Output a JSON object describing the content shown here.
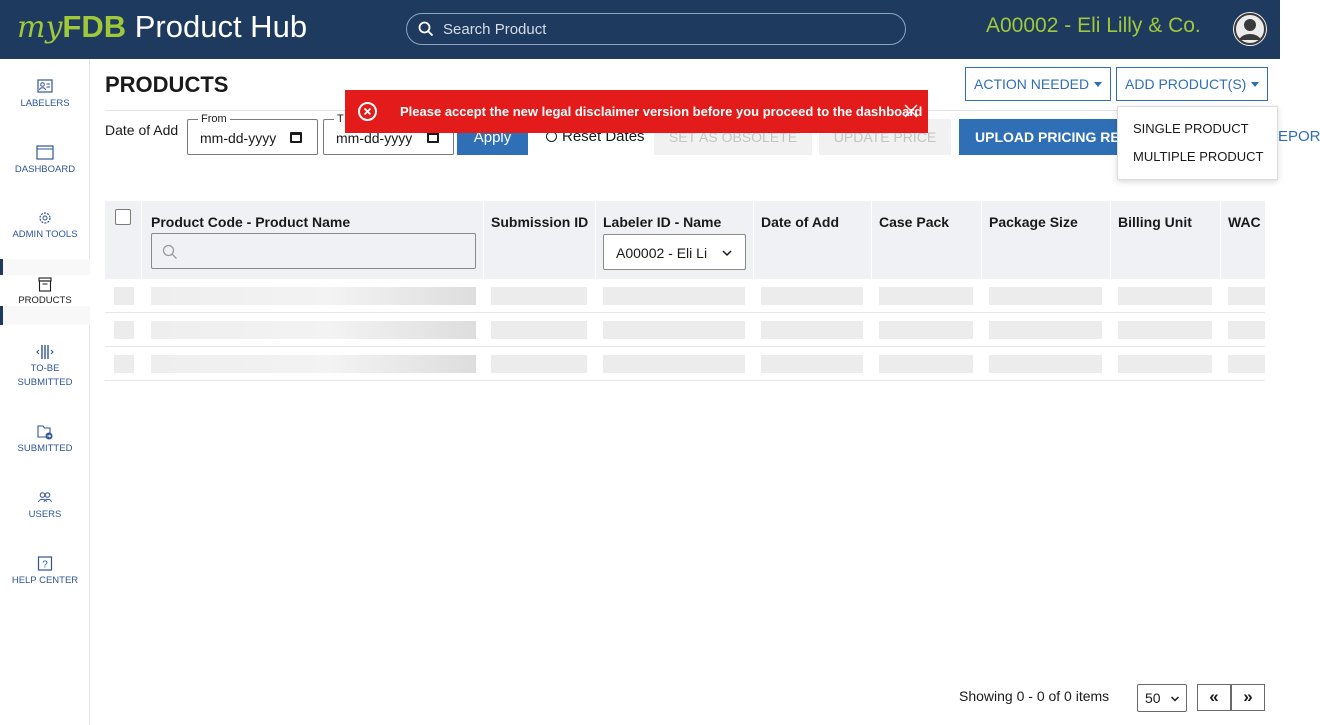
{
  "header": {
    "brand_my": "my",
    "brand_fdb": "FDB",
    "brand_rest": " Product Hub",
    "search_placeholder": "Search Product",
    "account_label": "A00002 - Eli Lilly & Co."
  },
  "sidebar": {
    "items": [
      {
        "label": "LABELERS",
        "icon": "labelers-icon"
      },
      {
        "label": "DASHBOARD",
        "icon": "dashboard-icon"
      },
      {
        "label": "ADMIN TOOLS",
        "icon": "gear-icon"
      },
      {
        "label": "PRODUCTS",
        "icon": "products-icon"
      },
      {
        "label": "TO-BE",
        "label2": "SUBMITTED",
        "icon": "to-be-submitted-icon"
      },
      {
        "label": "SUBMITTED",
        "icon": "submitted-folder-icon"
      },
      {
        "label": "USERS",
        "icon": "users-icon"
      },
      {
        "label": "HELP CENTER",
        "icon": "help-icon"
      }
    ],
    "active": "PRODUCTS"
  },
  "page": {
    "title": "PRODUCTS",
    "action_needed": "ACTION NEEDED",
    "add_products": "ADD PRODUCT(S)",
    "add_menu": [
      "SINGLE PRODUCT",
      "MULTIPLE PRODUCT"
    ]
  },
  "filters": {
    "date_label": "Date of Add",
    "from_legend": "From",
    "from_value": "mm-dd-yyyy",
    "to_legend": "T",
    "to_value": "mm-dd-yyyy",
    "apply": "Apply",
    "reset": "Reset Dates",
    "set_obsolete": "SET AS OBSOLETE",
    "update_price": "UPDATE PRICE",
    "upload_pricing": "UPLOAD PRICING RE",
    "export": "EPORT"
  },
  "toast": {
    "message": "Please accept the new legal disclaimer version before you proceed to the dashboard",
    "color": "#e31b1b"
  },
  "grid": {
    "columns": [
      "Product Code - Product Name",
      "Submission ID",
      "Labeler ID - Name",
      "Date of Add",
      "Case Pack",
      "Package Size",
      "Billing Unit",
      "WAC"
    ],
    "labeler_filter": "A00002 - Eli Li",
    "loading_rows": 3
  },
  "pager": {
    "summary": "Showing 0 - 0 of 0 items",
    "page_size": "50",
    "prev": "«",
    "next": "»"
  },
  "colors": {
    "topbar": "#1e3a5f",
    "brand_accent": "#9fc83a",
    "primary": "#2f6fb5"
  }
}
